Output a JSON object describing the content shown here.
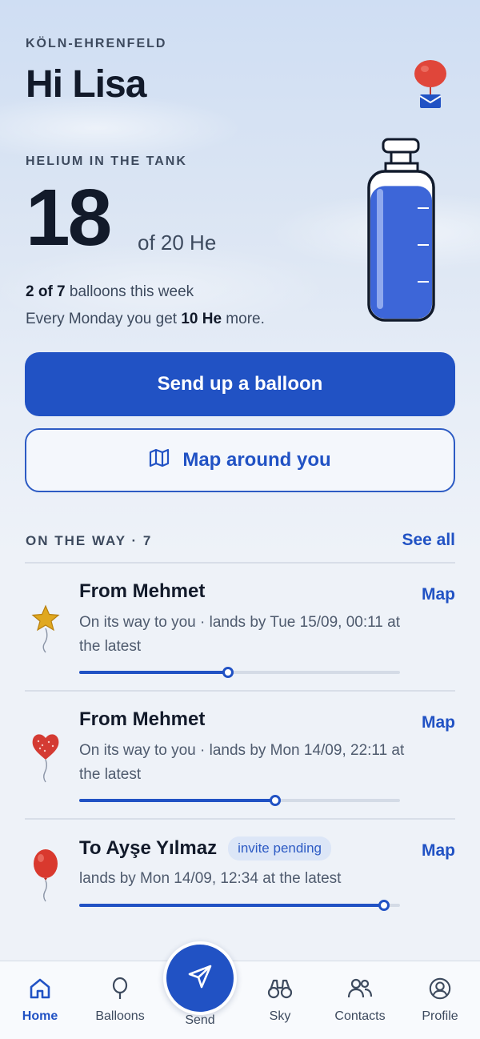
{
  "header": {
    "location": "KÖLN-EHRENFELD",
    "greeting": "Hi Lisa"
  },
  "tank": {
    "label": "HELIUM IN THE TANK",
    "value": "18",
    "of_text": "of 20 He",
    "fill_fraction": 0.9,
    "week_count": "2 of 7",
    "week_text": " balloons this week",
    "monday_prefix": "Every Monday you get ",
    "monday_amount": "10 He",
    "monday_suffix": " more."
  },
  "actions": {
    "send_label": "Send up a balloon",
    "map_label": "Map around you"
  },
  "on_the_way": {
    "title": "ON THE WAY · 7",
    "see_all": "See all",
    "items": [
      {
        "title": "From Mehmet",
        "badge": "",
        "desc": "On its way to you · lands by Tue 15/09, 00:11 at the latest",
        "map": "Map",
        "progress": 0.465,
        "icon": "star-balloon-icon"
      },
      {
        "title": "From Mehmet",
        "badge": "",
        "desc": "On its way to you · lands by Mon 14/09, 22:11 at the latest",
        "map": "Map",
        "progress": 0.61,
        "icon": "heart-balloon-icon"
      },
      {
        "title": "To Ayşe Yılmaz",
        "badge": "invite pending",
        "desc": "lands by Mon 14/09, 12:34 at the latest",
        "map": "Map",
        "progress": 0.95,
        "icon": "red-balloon-icon"
      }
    ]
  },
  "tabs": {
    "home": "Home",
    "balloons": "Balloons",
    "send": "Send",
    "sky": "Sky",
    "contacts": "Contacts",
    "profile": "Profile"
  },
  "colors": {
    "accent": "#2152c4",
    "text": "#121a2a",
    "muted": "#3d4a5e",
    "balloon_red": "#d9392e",
    "star_gold": "#e0a820"
  }
}
